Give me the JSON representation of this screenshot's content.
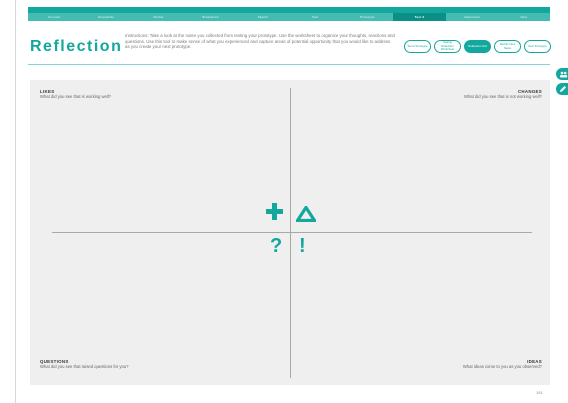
{
  "nav": {
    "steps": [
      "Connect",
      "Empathize",
      "Define",
      "Brainstorm",
      "Sketch",
      "Test",
      "Prototype",
      "Test 2",
      "Implement",
      "Next"
    ],
    "active_index": 7
  },
  "header": {
    "title": "Reflection",
    "instructions": "Instructions: Take a look at the notes you collected from testing your prototype. Use the worksheet to organize your thoughts, reactions and questions. Use this tool to make sense of what you experienced and capture areas of potential opportunity that you would like to address as you create your next prototype.",
    "tools": [
      {
        "label": "Test a Prototype",
        "active": false
      },
      {
        "label": "Testing Reflection Worksheet",
        "active": false
      },
      {
        "label": "Reflection Grid",
        "active": true
      },
      {
        "label": "Identify Next Steps",
        "active": false
      },
      {
        "label": "Next Prototype",
        "active": false
      }
    ]
  },
  "grid": {
    "likes": {
      "title": "LIKES",
      "prompt": "What did you see that is working well?"
    },
    "changes": {
      "title": "CHANGES",
      "prompt": "What did you see that is not working well?"
    },
    "questions": {
      "title": "QUESTIONS",
      "prompt": "What did you see that raised questions for you?"
    },
    "ideas": {
      "title": "IDEAS",
      "prompt": "What ideas come to you as you observed?"
    },
    "symbols": {
      "plus": "+",
      "delta": "Δ",
      "question": "?",
      "exclamation": "!"
    }
  },
  "footer": {
    "page_number": "191"
  },
  "colors": {
    "accent": "#13a89e",
    "panel": "#efefef",
    "divider": "#a8a8a8"
  }
}
